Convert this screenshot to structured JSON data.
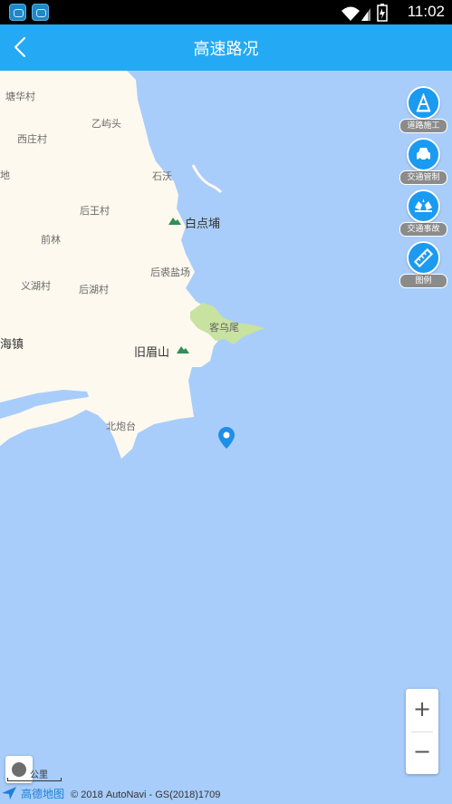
{
  "header": {
    "title": "高速路况"
  },
  "map": {
    "labels": {
      "tanghua": "塘华村",
      "yiyutou": "乙屿头",
      "xizhuang": "西庄村",
      "di": "地",
      "shiwo": "石沃",
      "houwang": "后王村",
      "baidianpu": "白点埔",
      "qianlin": "前林",
      "houyu": "后裘盐场",
      "yihu": "义湖村",
      "houhu": "后湖村",
      "kewuwei": "客乌尾",
      "haizhen": "海镇",
      "jiumeishan": "旧眉山",
      "beipaotai": "北炮台"
    }
  },
  "side_buttons": [
    {
      "label": "道路施工",
      "icon": "construction-cone-icon"
    },
    {
      "label": "交通管制",
      "icon": "traffic-control-car-icon"
    },
    {
      "label": "交通事故",
      "icon": "traffic-accident-icon"
    },
    {
      "label": "图例",
      "icon": "legend-ruler-icon"
    }
  ],
  "zoom": {
    "in": "+",
    "out": "−"
  },
  "scale": {
    "label": "公里"
  },
  "footer": {
    "brand": "高德地图",
    "copyright": "© 2018 AutoNavi - GS(2018)1709"
  },
  "status_bar": {
    "time": "11:02"
  },
  "colors": {
    "accent": "#24a9f4",
    "water": "#a8cdfb",
    "land": "#fdf9ef",
    "park": "#c8e2a0"
  }
}
